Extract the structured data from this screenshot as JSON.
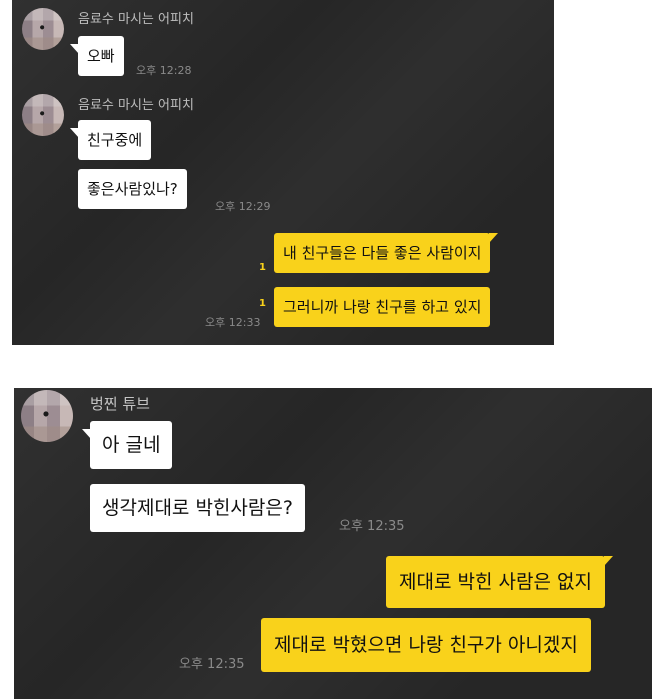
{
  "chat1": {
    "sender": "음료수 마시는 어피치",
    "messages": [
      {
        "text": "오빠",
        "time": "오후 12:28"
      },
      {
        "text": "친구중에"
      },
      {
        "text": "좋은사람있나?",
        "time": "오후 12:29"
      }
    ],
    "replies": [
      {
        "text": "내 친구들은 다들 좋은 사람이지",
        "unread": "1"
      },
      {
        "text": "그러니까 나랑 친구를 하고 있지",
        "unread": "1",
        "time": "오후 12:33"
      }
    ]
  },
  "chat2": {
    "sender": "벙찐 튜브",
    "messages": [
      {
        "text": "아 글네"
      },
      {
        "text": "생각제대로 박힌사람은?",
        "time": "오후 12:35"
      }
    ],
    "replies": [
      {
        "text": "제대로 박힌 사람은 없지"
      },
      {
        "text": "제대로 박혔으면 나랑 친구가 아니겠지",
        "time": "오후 12:35"
      }
    ]
  },
  "colors": {
    "panel": "#262626",
    "incoming": "#ffffff",
    "outgoing": "#f9d21b"
  }
}
